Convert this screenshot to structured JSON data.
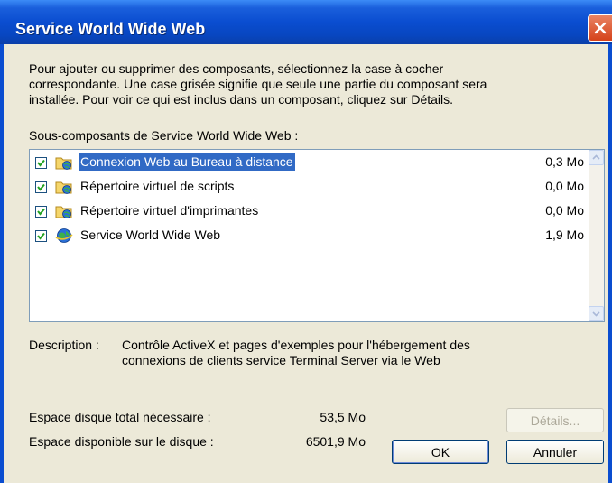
{
  "window": {
    "title": "Service World Wide Web"
  },
  "intro": [
    "Pour ajouter ou supprimer des composants, sélectionnez la case à cocher",
    "correspondante. Une case grisée signifie que seule une partie du composant sera",
    "installée. Pour voir ce qui est inclus dans un composant, cliquez sur Détails."
  ],
  "subcomponents_label": "Sous-composants de Service World Wide Web :",
  "components": [
    {
      "label": "Connexion Web au Bureau à distance",
      "size": "0,3 Mo",
      "checked": true,
      "selected": true,
      "icon": "folder-globe-icon"
    },
    {
      "label": "Répertoire virtuel de scripts",
      "size": "0,0 Mo",
      "checked": true,
      "selected": false,
      "icon": "folder-globe-icon"
    },
    {
      "label": "Répertoire virtuel d'imprimantes",
      "size": "0,0 Mo",
      "checked": true,
      "selected": false,
      "icon": "folder-globe-icon"
    },
    {
      "label": "Service World Wide Web",
      "size": "1,9 Mo",
      "checked": true,
      "selected": false,
      "icon": "globe-icon"
    }
  ],
  "description": {
    "label": "Description :",
    "lines": [
      "Contrôle ActiveX et pages d'exemples pour l'hébergement des",
      "connexions de clients service Terminal Server via le Web"
    ]
  },
  "disk": {
    "required_label": "Espace disque total nécessaire :",
    "required_value": "53,5 Mo",
    "available_label": "Espace disponible sur le disque :",
    "available_value": "6501,9 Mo"
  },
  "buttons": {
    "details": "Détails...",
    "ok": "OK",
    "cancel": "Annuler"
  },
  "colors": {
    "titlebar": "#0a4dd0",
    "selection": "#316ac5",
    "background": "#ece9d8"
  }
}
